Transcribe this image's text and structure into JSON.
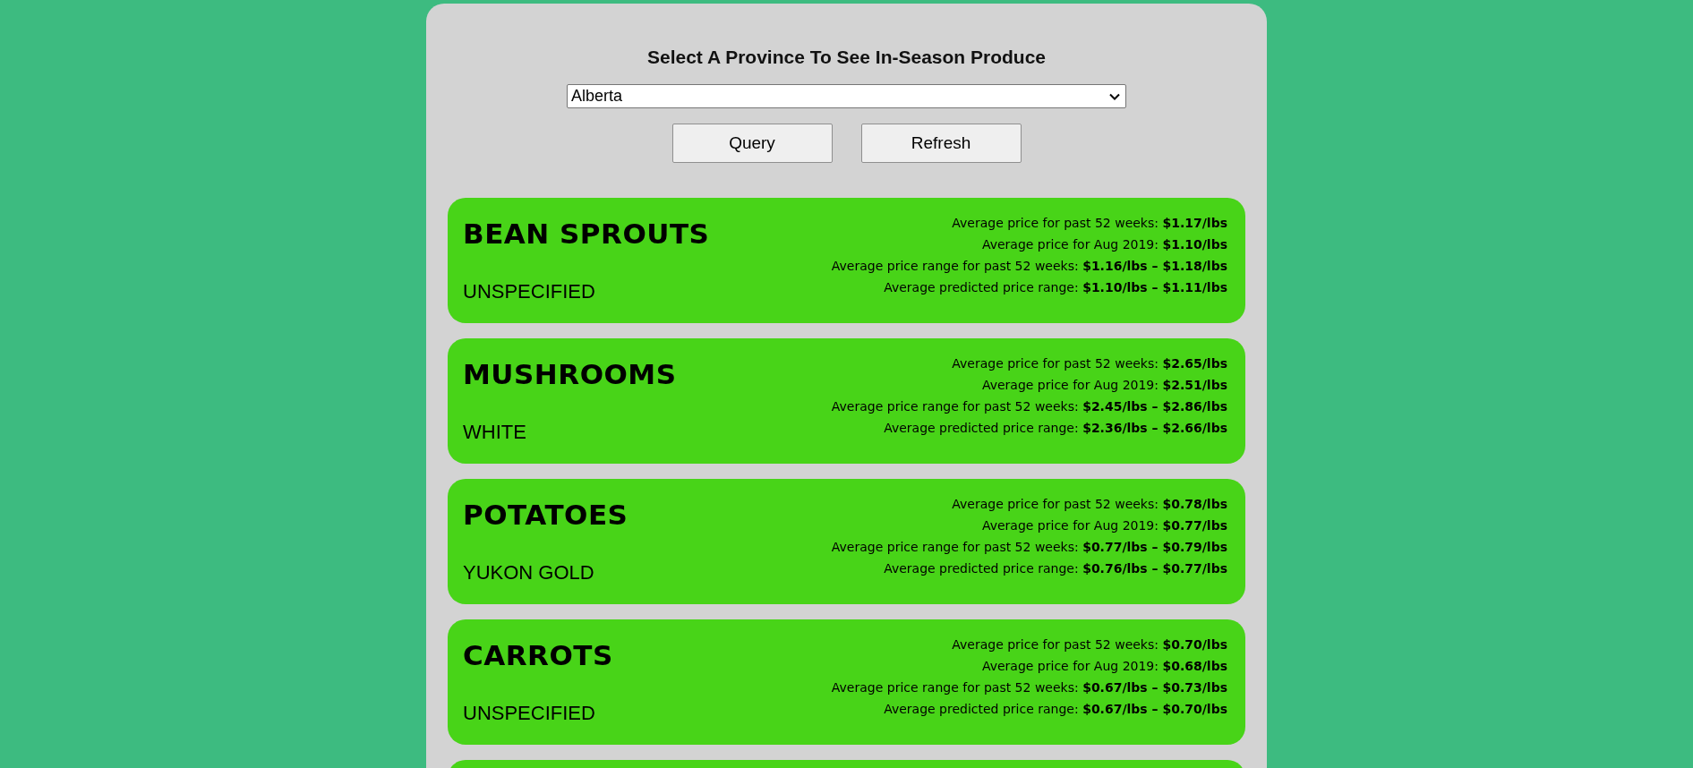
{
  "heading": "Select A Province To See In-Season Produce",
  "province_select": {
    "value": "Alberta"
  },
  "buttons": [
    "Query",
    "Refresh"
  ],
  "produce": [
    {
      "name": "BEAN SPROUTS",
      "variety": "UNSPECIFIED",
      "prices": [
        "Average price for past 52 weeks: **$1.17/lbs**",
        "Average price for Aug 2019: **$1.10/lbs**",
        "Average price range for past 52 weeks: **$1.16/lbs – $1.18/lbs**",
        "Average predicted price range: **$1.10/lbs – $1.11/lbs**"
      ]
    },
    {
      "name": "MUSHROOMS",
      "variety": "WHITE",
      "prices": [
        "Average price for past 52 weeks: **$2.65/lbs**",
        "Average price for Aug 2019: **$2.51/lbs**",
        "Average price range for past 52 weeks: **$2.45/lbs – $2.86/lbs**",
        "Average predicted price range: **$2.36/lbs – $2.66/lbs**"
      ]
    },
    {
      "name": "POTATOES",
      "variety": "YUKON GOLD",
      "prices": [
        "Average price for past 52 weeks: **$0.78/lbs**",
        "Average price for Aug 2019: **$0.77/lbs**",
        "Average price range for past 52 weeks: **$0.77/lbs – $0.79/lbs**",
        "Average predicted price range: **$0.76/lbs – $0.77/lbs**"
      ]
    },
    {
      "name": "CARROTS",
      "variety": "UNSPECIFIED",
      "prices": [
        "Average price for past 52 weeks: **$0.70/lbs**",
        "Average price for Aug 2019: **$0.68/lbs**",
        "Average price range for past 52 weeks: **$0.67/lbs – $0.73/lbs**",
        "Average predicted price range: **$0.67/lbs – $0.70/lbs**"
      ]
    }
  ]
}
